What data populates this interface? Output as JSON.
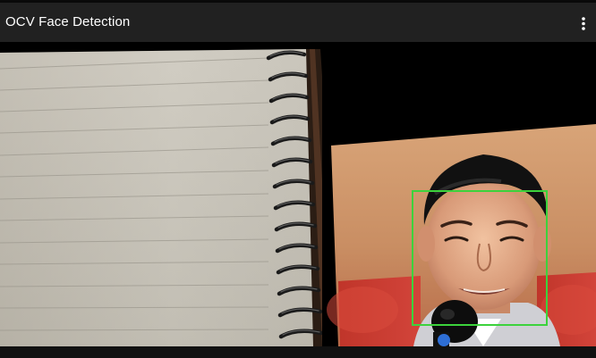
{
  "appbar": {
    "title": "OCV Face Detection",
    "overflow_icon": "more-vert-icon"
  },
  "preview": {
    "detection_color": "#3cd23c",
    "faces_detected": 1
  },
  "colors": {
    "appbar_bg": "#212121",
    "title_text": "#ffffff",
    "preview_bg": "#000000"
  }
}
